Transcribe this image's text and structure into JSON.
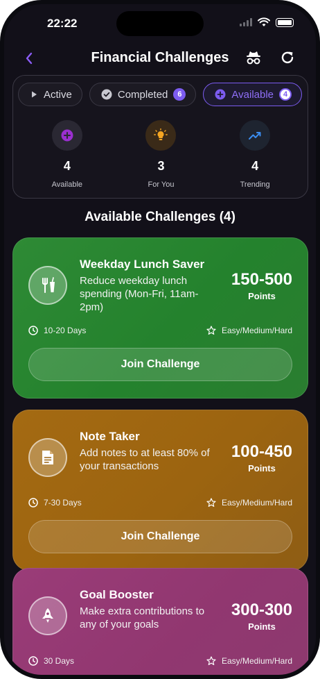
{
  "status_bar": {
    "time": "22:22"
  },
  "header": {
    "title": "Financial Challenges"
  },
  "tabs": [
    {
      "label": "Active"
    },
    {
      "label": "Completed",
      "badge": "6"
    },
    {
      "label": "Available",
      "badge": "4"
    }
  ],
  "stats": [
    {
      "value": "4",
      "label": "Available",
      "icon": "plus-circle-icon"
    },
    {
      "value": "3",
      "label": "For You",
      "icon": "lightbulb-icon"
    },
    {
      "value": "4",
      "label": "Trending",
      "icon": "trending-up-icon"
    }
  ],
  "section_title": "Available Challenges (4)",
  "challenges": [
    {
      "name": "Weekday Lunch Saver",
      "description": "Reduce weekday lunch spending (Mon-Fri, 11am-2pm)",
      "points": "150-500",
      "points_label": "Points",
      "duration": "10-20 Days",
      "difficulty": "Easy/Medium/Hard",
      "button": "Join Challenge",
      "icon": "restaurant-icon",
      "color": "#2a8a32"
    },
    {
      "name": "Note Taker",
      "description": "Add notes to at least 80% of your transactions",
      "points": "100-450",
      "points_label": "Points",
      "duration": "7-30 Days",
      "difficulty": "Easy/Medium/Hard",
      "button": "Join Challenge",
      "icon": "note-icon",
      "color": "#a06812"
    },
    {
      "name": "Goal Booster",
      "description": "Make extra contributions to any of your goals",
      "points": "300-300",
      "points_label": "Points",
      "duration": "30 Days",
      "difficulty": "Easy/Medium/Hard",
      "icon": "rocket-icon",
      "color": "#963a74"
    }
  ],
  "colors": {
    "accent": "#7c5cf0",
    "background": "#121019"
  }
}
